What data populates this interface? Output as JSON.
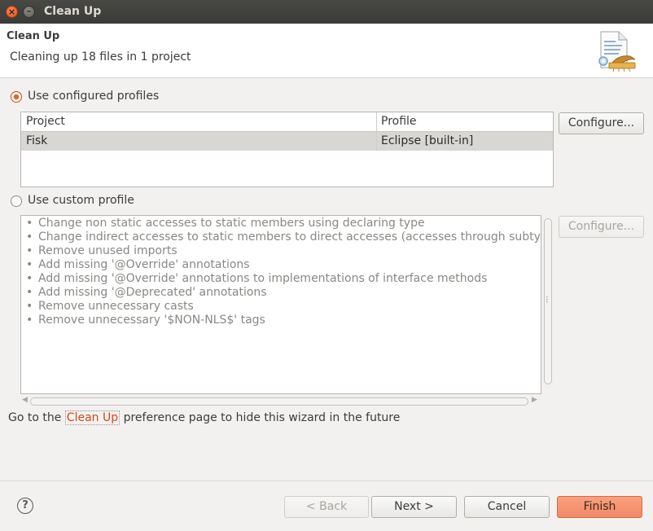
{
  "window": {
    "title": "Clean Up"
  },
  "header": {
    "title": "Clean Up",
    "message": "Cleaning up 18 files in 1 project",
    "icon": "clean-up-wizard-icon"
  },
  "configured": {
    "radio_label": "Use configured profiles",
    "selected": true,
    "columns": [
      "Project",
      "Profile"
    ],
    "rows": [
      {
        "project": "Fisk",
        "profile": "Eclipse [built-in]"
      }
    ],
    "configure_label": "Configure..."
  },
  "custom": {
    "radio_label": "Use custom profile",
    "selected": false,
    "configure_label": "Configure...",
    "items": [
      "Change non static accesses to static members using declaring type",
      "Change indirect accesses to static members to direct accesses (accesses through subtypes)",
      "Remove unused imports",
      "Add missing '@Override' annotations",
      "Add missing '@Override' annotations to implementations of interface methods",
      "Add missing '@Deprecated' annotations",
      "Remove unnecessary casts",
      "Remove unnecessary '$NON-NLS$' tags"
    ]
  },
  "footer": {
    "prefix": "Go to the ",
    "link": "Clean Up",
    "suffix": " preference page to hide this wizard in the future"
  },
  "buttons": {
    "help": "?",
    "back": "< Back",
    "next": "Next >",
    "cancel": "Cancel",
    "finish": "Finish"
  },
  "colors": {
    "accent": "#f18966",
    "link": "#d2481a",
    "radio_selected": "#e9622a"
  }
}
